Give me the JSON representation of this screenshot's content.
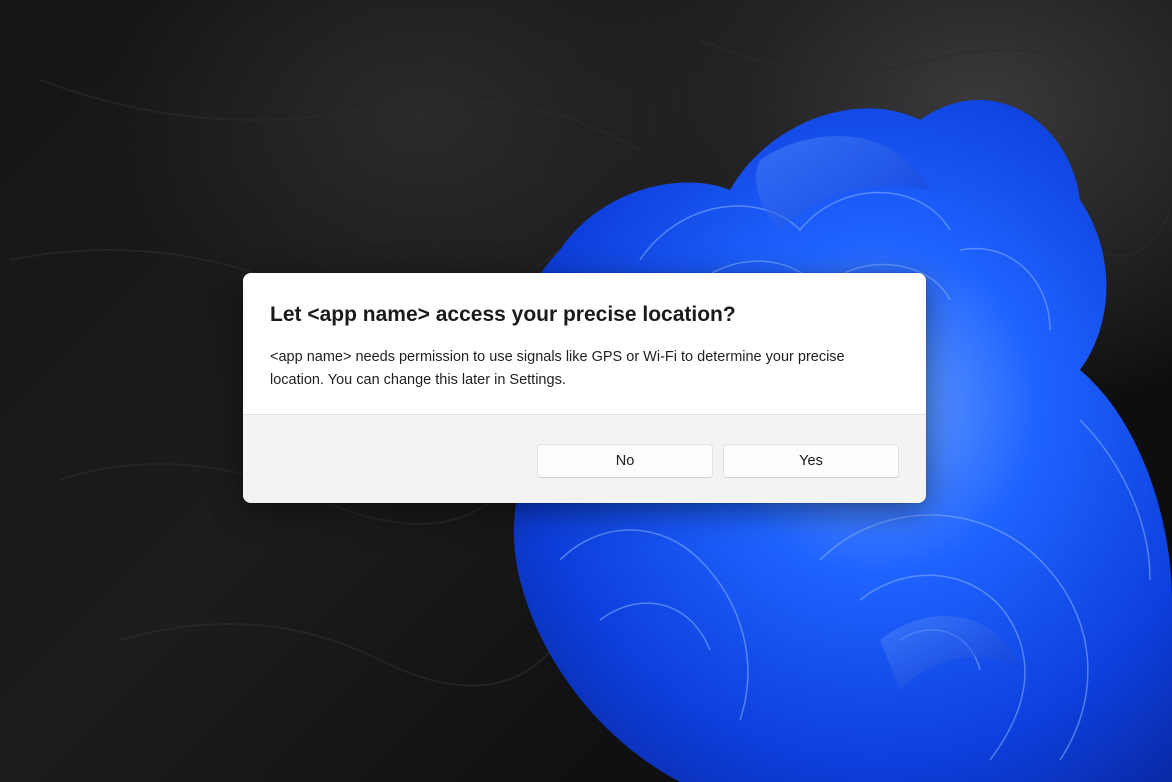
{
  "dialog": {
    "title": "Let <app name> access your precise location?",
    "message": "<app name> needs permission to use signals like GPS or Wi-Fi to determine your precise location. You can change this later in Settings.",
    "buttons": {
      "no_label": "No",
      "yes_label": "Yes"
    }
  },
  "colors": {
    "bloom_blue": "#1a5cff",
    "dialog_background": "#ffffff",
    "footer_background": "#f3f3f3"
  }
}
